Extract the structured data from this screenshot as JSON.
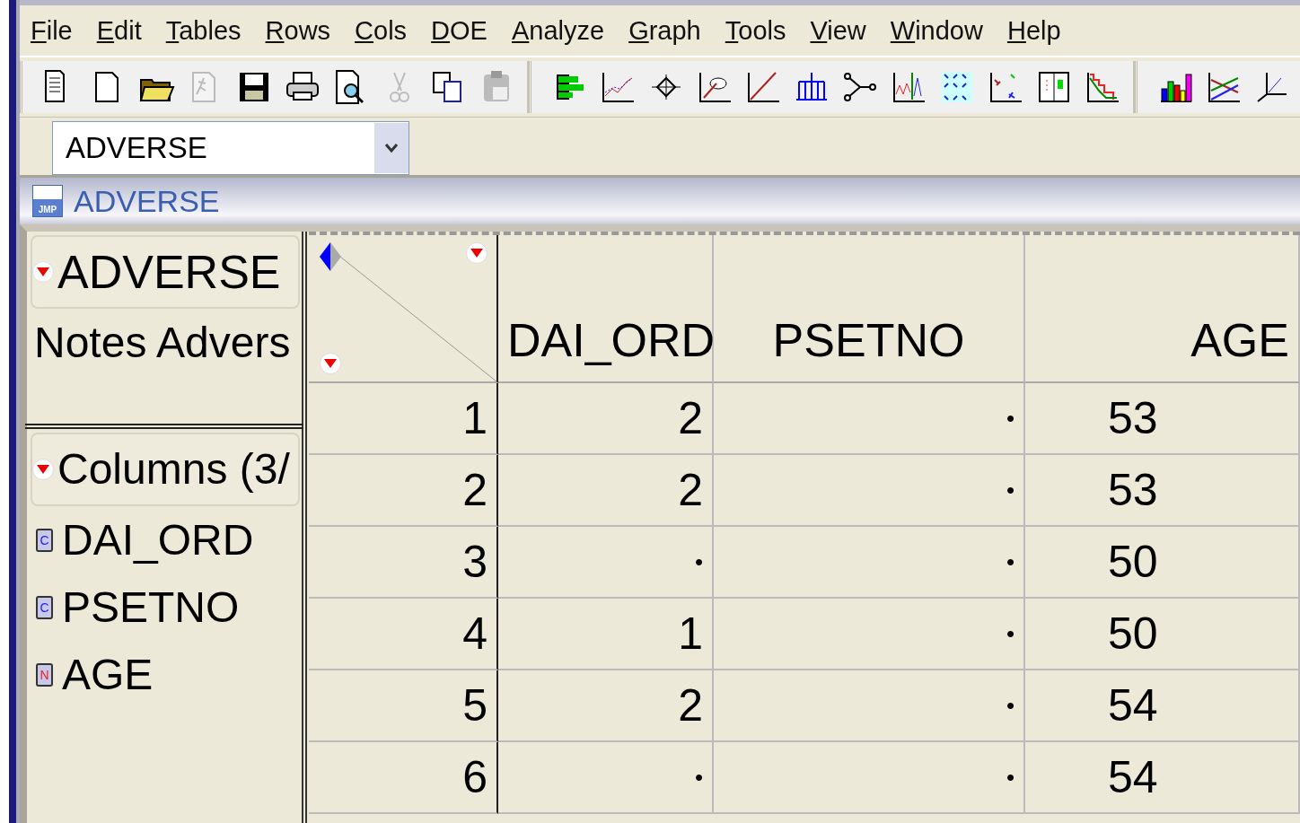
{
  "menu": [
    "File",
    "Edit",
    "Tables",
    "Rows",
    "Cols",
    "DOE",
    "Analyze",
    "Graph",
    "Tools",
    "View",
    "Window",
    "Help"
  ],
  "table_selector": {
    "value": "ADVERSE"
  },
  "document": {
    "title": "ADVERSE",
    "icon_text": "JMP"
  },
  "table_panel": {
    "title": "ADVERSE",
    "notes": "Notes Advers",
    "expanded": true
  },
  "columns_panel": {
    "title": "Columns (3/",
    "expanded": true,
    "items": [
      {
        "name": "DAI_ORD",
        "kind": "continuous",
        "type_mark": "C"
      },
      {
        "name": "PSETNO",
        "kind": "continuous",
        "type_mark": "C"
      },
      {
        "name": "AGE",
        "kind": "nominal",
        "type_mark": "N"
      }
    ]
  },
  "table": {
    "columns": [
      "DAI_ORD",
      "PSETNO",
      "AGE"
    ],
    "rows": [
      {
        "row": "1",
        "cells": [
          "2",
          "•",
          "53"
        ]
      },
      {
        "row": "2",
        "cells": [
          "2",
          "•",
          "53"
        ]
      },
      {
        "row": "3",
        "cells": [
          "•",
          "•",
          "50"
        ]
      },
      {
        "row": "4",
        "cells": [
          "1",
          "•",
          "50"
        ]
      },
      {
        "row": "5",
        "cells": [
          "2",
          "•",
          "54"
        ]
      },
      {
        "row": "6",
        "cells": [
          "•",
          "•",
          "54"
        ]
      }
    ]
  }
}
